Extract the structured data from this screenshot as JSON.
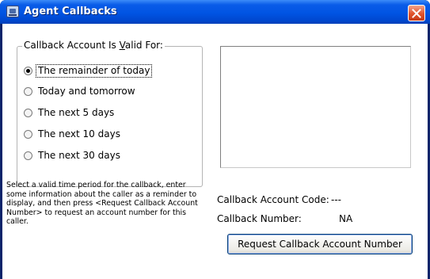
{
  "window": {
    "title": "Agent Callbacks",
    "app_icon": "agent-callbacks-icon",
    "close_icon": "close-icon"
  },
  "callback_validity": {
    "legend_before": "Callback Account Is ",
    "legend_mnemonic": "V",
    "legend_after": "alid For:",
    "selected_index": 0,
    "options": [
      {
        "label": "The remainder of today",
        "selected": true
      },
      {
        "label": "Today and tomorrow",
        "selected": false
      },
      {
        "label": "The next 5 days",
        "selected": false
      },
      {
        "label": "The next 10 days",
        "selected": false
      },
      {
        "label": "The next 30 days",
        "selected": false
      }
    ]
  },
  "instructions": {
    "text": "Select a valid time period for the callback, enter some information about the caller as a reminder to display, and then press <Request Callback Account Number> to request an account number for this caller."
  },
  "callback_info": {
    "account_code_label": "Callback Account Code:",
    "account_code_value": "---",
    "number_label": "Callback Number:",
    "number_value": "NA"
  },
  "actions": {
    "request_button_label": "Request Callback Account Number"
  },
  "colors": {
    "titlebar": "#0054e3",
    "close_button": "#e0532c",
    "button_border": "#003c74"
  }
}
